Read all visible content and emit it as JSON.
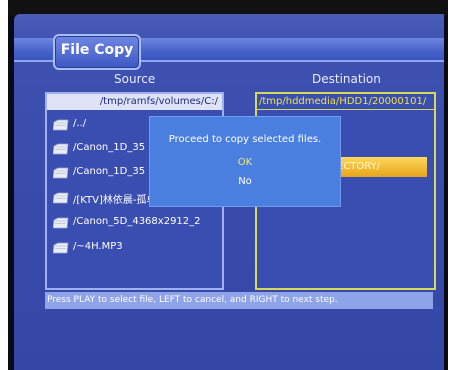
{
  "app": {
    "tab_title": "File Copy"
  },
  "source": {
    "title": "Source",
    "path": "/tmp/ramfs/volumes/C:/",
    "files": [
      {
        "name": "/../",
        "icon": "folder-icon"
      },
      {
        "name": "/Canon_1D_35",
        "icon": "folder-icon"
      },
      {
        "name": "/Canon_1D_35",
        "icon": "folder-icon"
      },
      {
        "name": "/[KTV]林依晨-孤单北半球.d",
        "icon": "folder-icon"
      },
      {
        "name": "/Canon_5D_4368x2912_2",
        "icon": "folder-icon"
      },
      {
        "name": "/~4H.MP3",
        "icon": "folder-icon"
      }
    ]
  },
  "destination": {
    "title": "Destination",
    "path": "/tmp/hddmedia/HDD1/20000101/",
    "selected_item": "ECTORY/"
  },
  "help": {
    "text": "Press PLAY to select file, LEFT to cancel, and RIGHT to next step."
  },
  "dialog": {
    "message": "Proceed to copy selected files.",
    "ok_label": "OK",
    "no_label": "No"
  },
  "colors": {
    "panel": "#3f52b2",
    "highlight": "#f0c040",
    "ok_text": "#f2e96a",
    "dest_border": "#d6d85a"
  }
}
